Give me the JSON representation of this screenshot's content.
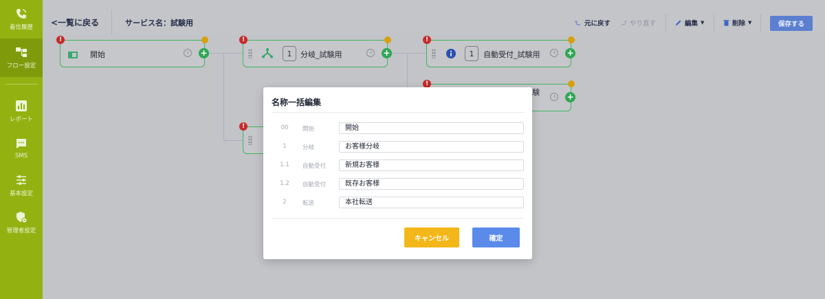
{
  "sidebar": {
    "items": [
      {
        "label": "着信履歴",
        "icon": "phone-icon"
      },
      {
        "label": "フロー設定",
        "icon": "flow-icon"
      },
      {
        "label": "レポート",
        "icon": "report-icon"
      },
      {
        "label": "SMS",
        "icon": "sms-icon"
      },
      {
        "label": "基本設定",
        "icon": "settings-sliders-icon"
      },
      {
        "label": "管理者設定",
        "icon": "admin-shield-icon"
      }
    ]
  },
  "header": {
    "back_label": "<一覧に戻る",
    "service_title": "サービス名：試験用",
    "undo_label": "元に戻す",
    "redo_label": "やり直す",
    "edit_label": "編集",
    "delete_label": "削除",
    "save_label": "保存する"
  },
  "flow": {
    "nodes": [
      {
        "label": "開始",
        "number": ""
      },
      {
        "label": "分岐_試験用",
        "number": "1"
      },
      {
        "label": "自動受付_試験用",
        "number": "1"
      },
      {
        "label": "験",
        "number": ""
      }
    ],
    "add_symbol": "+",
    "error_symbol": "!"
  },
  "modal": {
    "title": "名称一括編集",
    "rows": [
      {
        "index": "00",
        "type": "開始",
        "value": "開始"
      },
      {
        "index": "1",
        "type": "分岐",
        "value": "お客様分岐"
      },
      {
        "index": "1.1",
        "type": "自動受付",
        "value": "新規お客様"
      },
      {
        "index": "1.2",
        "type": "自動受付",
        "value": "既存お客様"
      },
      {
        "index": "2",
        "type": "転送",
        "value": "本社転送"
      }
    ],
    "cancel_label": "キャンセル",
    "confirm_label": "確定"
  },
  "colors": {
    "sidebar_bg": "#93b211",
    "save_button": "#5c7fd0",
    "cancel_button": "#f3b71a",
    "confirm_button": "#5a8bea",
    "node_border": "#3db55e",
    "error_badge": "#c82a2a"
  }
}
